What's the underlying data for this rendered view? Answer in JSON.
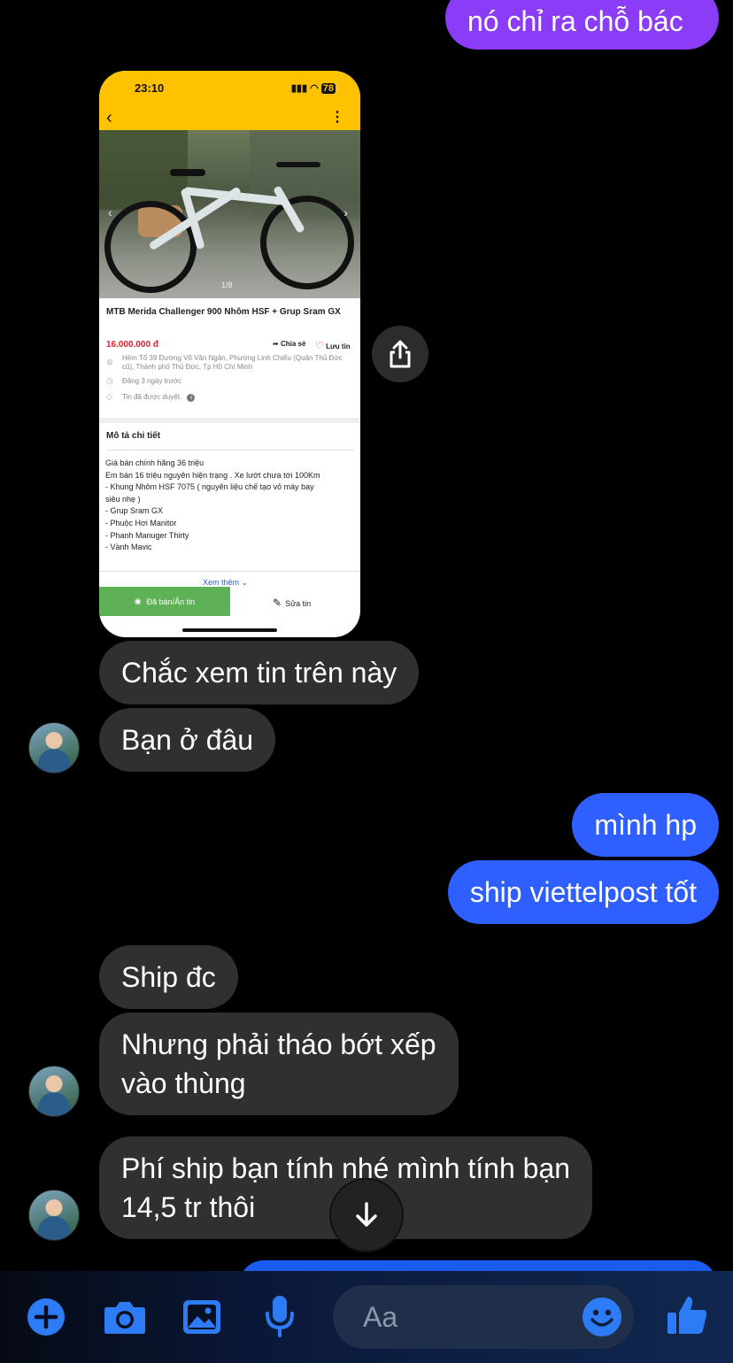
{
  "messages": {
    "m1": "nó chỉ ra chỗ bác",
    "m2": "Chắc xem tin trên này",
    "m3": "Bạn ở đâu",
    "m4": "mình hp",
    "m5": "ship viettelpost tốt",
    "m6": "Ship đc",
    "m7a": "Nhưng phải tháo bớt xếp",
    "m7b": "vào thùng",
    "m8a": "Phí ship bạn tính nhé mình tính bạn",
    "m8b": "14,5 tr thôi"
  },
  "shared_screenshot": {
    "time": "23:10",
    "battery": "78",
    "photo_counter": "1/8",
    "listing_title": "MTB Merida Challenger 900 Nhôm HSF + Grup Sram GX",
    "price": "16.000.000 đ",
    "share_label": "Chia sẻ",
    "save_label": "Lưu tin",
    "address": "Hẻm Tổ 39 Đường Võ Văn Ngân, Phường Linh Chiểu (Quận Thủ Đức cũ), Thành phố Thủ Đức, Tp Hồ Chí Minh",
    "posted": "Đăng 3 ngày trước",
    "approved": "Tin đã được duyệt.",
    "section_title": "Mô tả chi tiết",
    "desc": [
      "Giá bán chính hãng 36 triệu",
      "Em bán 16 triệu nguyên hiện trạng . Xe lướt chưa tới 100Km",
      "- Khung Nhôm HSF 7075 ( nguyên liệu chế tạo vỏ máy bay",
      "siêu nhẹ )",
      "- Grup Sram GX",
      "- Phuộc Hơi Manitor",
      "- Phanh Manuger Thirty",
      "- Vành Mavic"
    ],
    "see_more": "Xem thêm",
    "sold_button": "Đã bán/Ẩn tin",
    "edit_button": "Sửa tin"
  },
  "composer": {
    "placeholder": "Aa"
  },
  "colors": {
    "outgoing": "#2f5fff",
    "outgoing_top": "#8a3cf7",
    "incoming": "#303030",
    "accent_icon": "#2d7cf6"
  },
  "icons": [
    "plus-circle-icon",
    "camera-icon",
    "image-icon",
    "microphone-icon",
    "emoji-icon",
    "thumbs-up-icon",
    "share-icon",
    "arrow-down-icon"
  ]
}
